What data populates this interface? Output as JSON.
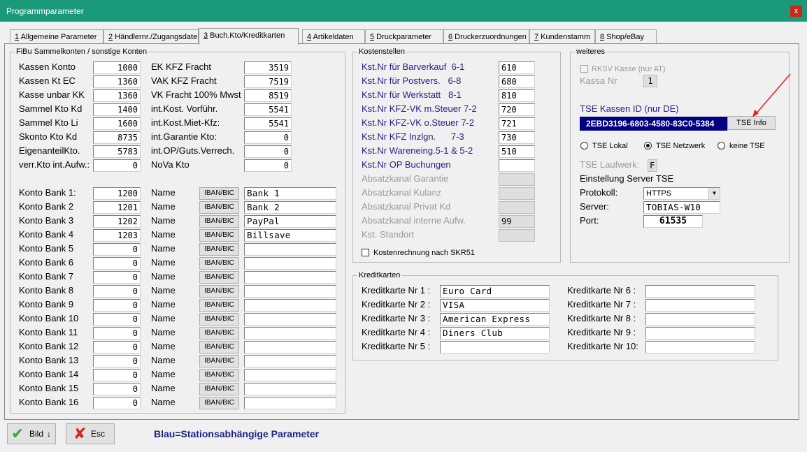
{
  "window": {
    "title": "Programmparameter",
    "close": "x"
  },
  "tabs": [
    {
      "num": "1",
      "label": " Allgemeine Parameter"
    },
    {
      "num": "2",
      "label": " Händlernr./Zugangsdaten"
    },
    {
      "num": "3",
      "label": " Buch.Kto/Kreditkarten"
    },
    {
      "num": "4",
      "label": " Artikeldaten"
    },
    {
      "num": "5",
      "label": " Druckparameter"
    },
    {
      "num": "6",
      "label": " Druckerzuordnungen"
    },
    {
      "num": "7",
      "label": " Kundenstamm"
    },
    {
      "num": "8",
      "label": " Shop/eBay"
    }
  ],
  "fibu": {
    "title": "FiBu Sammelkonten / sonstige Konten",
    "left": [
      {
        "label": "Kassen Konto",
        "value": "1000"
      },
      {
        "label": "Kassen Kt EC",
        "value": "1360"
      },
      {
        "label": "Kasse unbar KK",
        "value": "1360"
      },
      {
        "label": "Sammel Kto Kd",
        "value": "1400"
      },
      {
        "label": "Sammel Kto Li",
        "value": "1600"
      },
      {
        "label": "Skonto Kto Kd",
        "value": "8735"
      },
      {
        "label": "EigenanteilKto.",
        "value": "5783"
      },
      {
        "label": "verr.Kto int.Aufw.:",
        "value": "0"
      }
    ],
    "right": [
      {
        "label": "EK KFZ Fracht",
        "value": "3519"
      },
      {
        "label": "VAK KFZ Fracht",
        "value": "7519"
      },
      {
        "label": "VK Fracht 100% Mwst",
        "value": "8519"
      },
      {
        "label": "int.Kost. Vorführ.",
        "value": "5541"
      },
      {
        "label": "int.Kost.Miet-Kfz:",
        "value": "5541"
      },
      {
        "label": "int.Garantie Kto:",
        "value": "0"
      },
      {
        "label": "int.OP/Guts.Verrech.",
        "value": "0"
      },
      {
        "label": "NoVa Kto",
        "value": "0"
      }
    ],
    "banks": [
      {
        "label": "Konto Bank 1:",
        "value": "1200",
        "name": "Bank 1"
      },
      {
        "label": "Konto Bank 2",
        "value": "1201",
        "name": "Bank 2"
      },
      {
        "label": "Konto Bank 3",
        "value": "1202",
        "name": "PayPal"
      },
      {
        "label": "Konto Bank 4",
        "value": "1203",
        "name": "Billsave"
      },
      {
        "label": "Konto Bank 5",
        "value": "0",
        "name": ""
      },
      {
        "label": "Konto Bank 6",
        "value": "0",
        "name": ""
      },
      {
        "label": "Konto Bank 7",
        "value": "0",
        "name": ""
      },
      {
        "label": "Konto Bank 8",
        "value": "0",
        "name": ""
      },
      {
        "label": "Konto Bank 9",
        "value": "0",
        "name": ""
      },
      {
        "label": "Konto Bank 10",
        "value": "0",
        "name": ""
      },
      {
        "label": "Konto Bank 11",
        "value": "0",
        "name": ""
      },
      {
        "label": "Konto Bank 12",
        "value": "0",
        "name": ""
      },
      {
        "label": "Konto Bank 13",
        "value": "0",
        "name": ""
      },
      {
        "label": "Konto Bank 14",
        "value": "0",
        "name": ""
      },
      {
        "label": "Konto Bank 15",
        "value": "0",
        "name": ""
      },
      {
        "label": "Konto Bank 16",
        "value": "0",
        "name": ""
      }
    ],
    "name_label": "Name",
    "iban_label": "IBAN/BIC"
  },
  "kosten": {
    "title": "Kostenstellen",
    "rows": [
      {
        "label": "Kst.Nr für Barverkauf  6-1",
        "value": "610",
        "enabled": true
      },
      {
        "label": "Kst.Nr für Postvers.   6-8",
        "value": "680",
        "enabled": true
      },
      {
        "label": "Kst.Nr für Werkstatt   8-1",
        "value": "810",
        "enabled": true
      },
      {
        "label": "Kst.Nr KFZ-VK m.Steuer 7-2",
        "value": "720",
        "enabled": true
      },
      {
        "label": "Kst.Nr KFZ-VK o.Steuer 7-2",
        "value": "721",
        "enabled": true
      },
      {
        "label": "Kst.Nr KFZ Inzlgn.      7-3",
        "value": "730",
        "enabled": true
      },
      {
        "label": "Kst.Nr Wareneing.5-1 & 5-2",
        "value": "510",
        "enabled": true
      },
      {
        "label": "Kst.Nr OP Buchungen",
        "value": "",
        "enabled": true
      },
      {
        "label": "Absatzkanal Garantie",
        "value": "",
        "enabled": false
      },
      {
        "label": "Absatzkanal Kulanz",
        "value": "",
        "enabled": false
      },
      {
        "label": "Absatzkanal Privat Kd",
        "value": "",
        "enabled": false
      },
      {
        "label": "Absatzkanal interne Aufw.",
        "value": "99",
        "enabled": false
      },
      {
        "label": "Kst. Standort",
        "value": "",
        "enabled": false
      }
    ],
    "skr51_label": "Kostenrechnung nach SKR51"
  },
  "weiteres": {
    "title": "weiteres",
    "rksv_label": "RKSV Kasse (nur AT)",
    "kassa_nr_label": "Kassa Nr",
    "kassa_nr_value": "1",
    "tse_id_label": "TSE Kassen ID (nur DE)",
    "tse_id_value": "2EBD3196-6803-4580-83C0-5384",
    "tse_info_button": "TSE Info",
    "radio_lokal": "TSE Lokal",
    "radio_netzwerk": "TSE Netzwerk",
    "radio_keine": "keine TSE",
    "laufwerk_label": "TSE Laufwerk:",
    "laufwerk_value": "F",
    "einstellung_label": "Einstellung Server TSE",
    "protokoll_label": "Protokoll:",
    "protokoll_value": "HTTPS",
    "server_label": "Server:",
    "server_value": "TOBIAS-W10",
    "port_label": "Port:",
    "port_value": "61535"
  },
  "kredit": {
    "title": "Kreditkarten",
    "left": [
      {
        "label": "Kreditkarte Nr 1 :",
        "value": "Euro Card"
      },
      {
        "label": "Kreditkarte Nr 2 :",
        "value": "VISA"
      },
      {
        "label": "Kreditkarte Nr 3 :",
        "value": "American Express"
      },
      {
        "label": "Kreditkarte Nr 4 :",
        "value": "Diners Club"
      },
      {
        "label": "Kreditkarte Nr 5 :",
        "value": ""
      }
    ],
    "right": [
      {
        "label": "Kreditkarte Nr 6 :",
        "value": ""
      },
      {
        "label": "Kreditkarte Nr 7 :",
        "value": ""
      },
      {
        "label": "Kreditkarte Nr 8 :",
        "value": ""
      },
      {
        "label": "Kreditkarte Nr 9 :",
        "value": ""
      },
      {
        "label": "Kreditkarte Nr 10:",
        "value": ""
      }
    ]
  },
  "footer": {
    "bild_button": "Bild",
    "esc_button": "Esc",
    "note": "Blau=Stationsabhängige Parameter",
    "note_color": "#1f1f8c"
  },
  "colors": {
    "titlebar": "#1a9a7b",
    "tse_field": "#000080",
    "arrow": "#e8201a"
  }
}
